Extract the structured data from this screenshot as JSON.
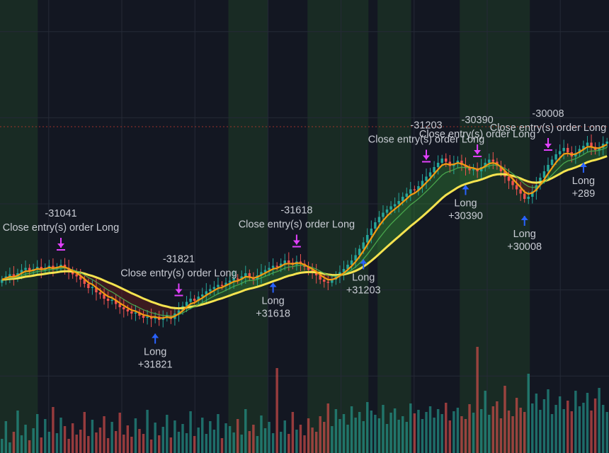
{
  "chart_data": {
    "type": "candlestick",
    "colors": {
      "background": "#131722",
      "session_band": "#1c3326",
      "grid": "#252a36",
      "price_line": "#c0392b",
      "up": "#26a69a",
      "down": "#ef5350",
      "fast_ma": "#f39c12",
      "slow_ma": "#f5e34f",
      "mid_ma": "#4caf50",
      "fill_bull": "#2e7d32",
      "fill_bear": "#6d2020",
      "long_arrow": "#2962ff",
      "close_arrow": "#e040fb"
    },
    "closes": [
      5.0,
      5.3,
      5.5,
      5.2,
      5.6,
      5.9,
      6.1,
      5.8,
      6.0,
      6.2,
      5.9,
      6.1,
      6.3,
      6.0,
      6.2,
      6.4,
      6.1,
      5.8,
      5.5,
      5.3,
      5.0,
      4.6,
      4.2,
      4.3,
      3.8,
      3.6,
      3.2,
      3.0,
      3.1,
      2.7,
      2.4,
      2.2,
      2.0,
      1.8,
      1.9,
      1.6,
      1.4,
      1.5,
      1.3,
      1.5,
      1.2,
      1.4,
      1.6,
      1.3,
      1.8,
      2.1,
      2.5,
      2.9,
      3.2,
      3.0,
      3.4,
      3.6,
      3.9,
      4.1,
      4.3,
      4.5,
      4.4,
      4.7,
      4.9,
      5.1,
      5.0,
      5.3,
      5.6,
      5.2,
      5.0,
      5.4,
      5.7,
      5.9,
      6.1,
      6.3,
      6.2,
      6.5,
      6.8,
      6.6,
      6.4,
      6.7,
      6.5,
      6.2,
      5.9,
      5.7,
      5.4,
      5.0,
      4.8,
      4.7,
      5.0,
      5.3,
      5.7,
      6.0,
      6.4,
      6.8,
      7.3,
      7.9,
      8.5,
      9.2,
      9.8,
      10.4,
      10.9,
      11.3,
      11.6,
      11.9,
      12.1,
      12.4,
      12.8,
      13.1,
      13.5,
      13.4,
      13.8,
      14.3,
      14.7,
      15.1,
      15.6,
      16.0,
      16.4,
      16.1,
      15.7,
      15.9,
      16.2,
      15.8,
      15.5,
      15.3,
      15.4,
      15.2,
      15.6,
      16.0,
      16.3,
      16.1,
      15.7,
      15.2,
      14.7,
      14.3,
      13.9,
      13.5,
      13.1,
      12.6,
      12.8,
      13.3,
      13.9,
      14.6,
      15.2,
      15.8,
      16.3,
      16.8,
      17.1,
      17.4,
      17.0,
      16.6,
      16.9,
      17.3,
      17.6,
      17.9,
      17.5,
      17.2,
      17.4,
      17.8,
      18.0
    ],
    "volumes": [
      20,
      45,
      15,
      30,
      60,
      25,
      40,
      18,
      35,
      55,
      22,
      48,
      30,
      65,
      28,
      50,
      38,
      20,
      42,
      26,
      33,
      58,
      24,
      47,
      29,
      36,
      52,
      21,
      44,
      31,
      57,
      26,
      39,
      23,
      49,
      34,
      27,
      61,
      19,
      43,
      25,
      37,
      54,
      22,
      46,
      30,
      41,
      28,
      59,
      24,
      36,
      50,
      27,
      45,
      33,
      55,
      21,
      42,
      38,
      29,
      48,
      26,
      62,
      31,
      40,
      24,
      53,
      35,
      44,
      28,
      120,
      30,
      46,
      27,
      58,
      33,
      40,
      25,
      49,
      36,
      30,
      52,
      44,
      70,
      38,
      62,
      48,
      55,
      40,
      66,
      50,
      58,
      45,
      72,
      60,
      54,
      49,
      68,
      41,
      57,
      63,
      47,
      52,
      44,
      70,
      56,
      61,
      48,
      58,
      66,
      50,
      62,
      55,
      71,
      46,
      59,
      64,
      52,
      48,
      69,
      57,
      150,
      62,
      88,
      54,
      66,
      73,
      49,
      95,
      60,
      52,
      78,
      64,
      58,
      112,
      70,
      84,
      61,
      76,
      90,
      55,
      68,
      80,
      62,
      74,
      59,
      88,
      66,
      71,
      85,
      60,
      77,
      92,
      68,
      58
    ],
    "session_bands": [
      [
        0,
        0.062
      ],
      [
        0.375,
        0.44
      ],
      [
        0.505,
        0.605
      ],
      [
        0.62,
        0.675
      ],
      [
        0.755,
        0.87
      ]
    ],
    "signals": [
      {
        "kind": "close",
        "text": "Close entry(s) order Long",
        "pnl": "-31041"
      },
      {
        "kind": "long",
        "text": "Long",
        "pnl": "+31821"
      },
      {
        "kind": "close",
        "text": "Close entry(s) order Long",
        "pnl": "-31821"
      },
      {
        "kind": "long",
        "text": "Long",
        "pnl": "+31618"
      },
      {
        "kind": "close",
        "text": "Close entry(s) order Long",
        "pnl": "-31618"
      },
      {
        "kind": "long",
        "text": "Long",
        "pnl": "+31203"
      },
      {
        "kind": "close",
        "text": "Close entry(s) order Long",
        "pnl": "-31203"
      },
      {
        "kind": "long",
        "text": "Long",
        "pnl": "+30390"
      },
      {
        "kind": "close",
        "text": "Close entry(s) order Long",
        "pnl": "-30390"
      },
      {
        "kind": "long",
        "text": "Long",
        "pnl": "+30008"
      },
      {
        "kind": "close",
        "text": "Close entry(s) order Long",
        "pnl": "-30008"
      },
      {
        "kind": "long",
        "text": "Long",
        "pnl": "+289"
      }
    ]
  }
}
